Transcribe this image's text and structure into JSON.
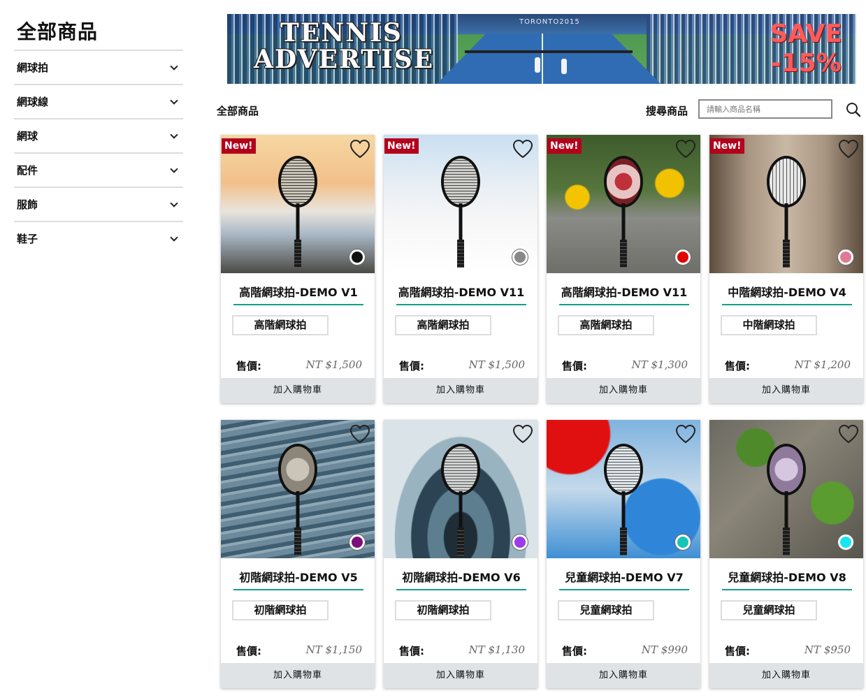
{
  "sidebar": {
    "title": "全部商品",
    "categories": [
      "網球拍",
      "網球線",
      "網球",
      "配件",
      "服飾",
      "鞋子"
    ]
  },
  "banner": {
    "line1": "TENNIS",
    "line2": "ADVERTISE",
    "save1": "SAVE",
    "save2": "-15%",
    "logo": "TORONTO2015"
  },
  "toolbar": {
    "crumb": "全部商品",
    "search_label": "搜尋商品",
    "search_placeholder": "請輸入商品名稱"
  },
  "products": [
    {
      "name": "高階網球拍-DEMO V1",
      "tag": "高階網球拍",
      "price_label": "售價:",
      "price": "NT $1,500",
      "cart": "加入購物車",
      "badge": "New!",
      "color": "#111111",
      "bg": "sunset"
    },
    {
      "name": "高階網球拍-DEMO V11",
      "tag": "高階網球拍",
      "price_label": "售價:",
      "price": "NT $1,500",
      "cart": "加入購物車",
      "badge": "New!",
      "color": "#888888",
      "bg": "snow"
    },
    {
      "name": "高階網球拍-DEMO V11",
      "tag": "高階網球拍",
      "price_label": "售價:",
      "price": "NT $1,300",
      "cart": "加入購物車",
      "badge": "New!",
      "color": "#e00000",
      "bg": "flowers"
    },
    {
      "name": "中階網球拍-DEMO V4",
      "tag": "中階網球拍",
      "price_label": "售價:",
      "price": "NT $1,200",
      "cart": "加入購物車",
      "badge": "New!",
      "color": "#e07a94",
      "bg": "sand"
    },
    {
      "name": "初階網球拍-DEMO V5",
      "tag": "初階網球拍",
      "price_label": "售價:",
      "price": "NT $1,150",
      "cart": "加入購物車",
      "badge": "",
      "color": "#7a0f7a",
      "bg": "water"
    },
    {
      "name": "初階網球拍-DEMO V6",
      "tag": "初階網球拍",
      "price_label": "售價:",
      "price": "NT $1,130",
      "cart": "加入購物車",
      "badge": "",
      "color": "#9b3be8",
      "bg": "ripple"
    },
    {
      "name": "兒童網球拍-DEMO V7",
      "tag": "兒童網球拍",
      "price_label": "售價:",
      "price": "NT $990",
      "cart": "加入購物車",
      "badge": "",
      "color": "#16c4b8",
      "bg": "paint"
    },
    {
      "name": "兒童網球拍-DEMO V8",
      "tag": "兒童網球拍",
      "price_label": "售價:",
      "price": "NT $950",
      "cart": "加入購物車",
      "badge": "",
      "color": "#16e6f0",
      "bg": "moss"
    }
  ]
}
